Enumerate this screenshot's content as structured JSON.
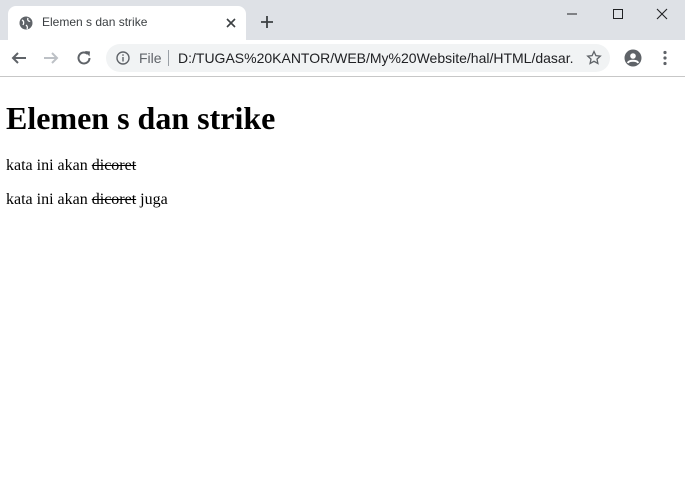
{
  "browser": {
    "tab": {
      "title": "Elemen s dan strike",
      "favicon": "globe-icon"
    },
    "window_controls": [
      "minimize-icon",
      "maximize-icon",
      "close-icon"
    ],
    "toolbar": {
      "omnibox_scheme_label": "File",
      "url": "D:/TUGAS%20KANTOR/WEB/My%20Website/hal/HTML/dasar..."
    }
  },
  "page": {
    "heading": "Elemen s dan strike",
    "paragraphs": [
      {
        "before": "kata ini akan ",
        "struck": "dicoret",
        "after": ""
      },
      {
        "before": "kata ini akan ",
        "struck": "dicoret",
        "after": " juga"
      }
    ]
  }
}
